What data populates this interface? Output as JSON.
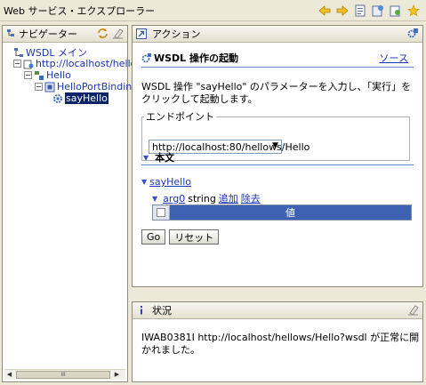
{
  "window": {
    "title": "Web サービス・エクスプローラー"
  },
  "toolbar": {
    "icons": [
      "back-arrow-icon",
      "forward-arrow-icon",
      "wsdl-page-icon",
      "uddi-page-icon",
      "wsil-page-icon",
      "favorites-star-icon"
    ]
  },
  "navigator": {
    "title": "ナビゲーター",
    "tree": {
      "root": "WSDL メイン",
      "wsdl": "http://localhost/hellows/",
      "service": "Hello",
      "binding": "HelloPortBinding",
      "operation": "sayHello"
    },
    "scroll_mark": "III"
  },
  "actions": {
    "title": "アクション",
    "heading": "WSDL 操作の起動",
    "help_link": "ソース",
    "description": "WSDL 操作 \"sayHello\" のパラメーターを入力し、「実行」をクリックして起動します。",
    "endpoint_legend": "エンドポイント",
    "endpoint_value": "http://localhost:80/hellows/Hello",
    "body_label": "本文",
    "method_name": "sayHello",
    "arg": {
      "name": "arg0",
      "type": "string",
      "add_label": "追加",
      "remove_label": "除去"
    },
    "value_header": "値",
    "go_label": "Go",
    "reset_label": "リセット"
  },
  "status": {
    "title": "状況",
    "message": "IWAB0381I http://localhost/hellows/Hello?wsdl が正常に開かれました。"
  },
  "colors": {
    "link": "#1b35b8",
    "value_header_bg": "#3d62b2",
    "selection_bg": "#0a246a",
    "rule": "#6e86c8"
  }
}
